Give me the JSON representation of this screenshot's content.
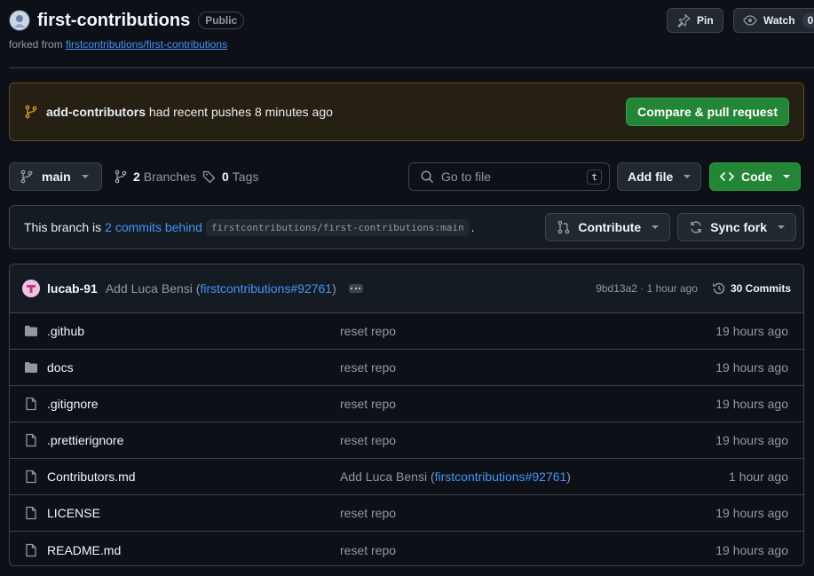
{
  "repo": {
    "name": "first-contributions",
    "visibility": "Public",
    "forked_prefix": "forked from",
    "forked_from": "firstcontributions/first-contributions"
  },
  "header_actions": {
    "pin_label": "Pin",
    "watch_label": "Watch",
    "watch_count": "0"
  },
  "recent_push": {
    "branch": "add-contributors",
    "text": "had recent pushes 8 minutes ago",
    "button": "Compare & pull request"
  },
  "toolbar": {
    "branch": "main",
    "branches_count": "2",
    "branches_label": "Branches",
    "tags_count": "0",
    "tags_label": "Tags",
    "search_placeholder": "Go to file",
    "search_shortcut": "t",
    "add_file": "Add file",
    "code": "Code"
  },
  "branch_info": {
    "prefix": "This branch is",
    "behind_link": "2 commits behind",
    "upstream": "firstcontributions/first-contributions:main",
    "suffix": ".",
    "contribute": "Contribute",
    "sync_fork": "Sync fork"
  },
  "last_commit": {
    "author": "lucab-91",
    "message_prefix": "Add Luca Bensi (",
    "message_link": "firstcontributions#92761",
    "message_suffix": ")",
    "hash_time": "9bd13a2 · 1 hour ago",
    "commits": "30 Commits"
  },
  "files": [
    {
      "name": ".github",
      "type": "folder",
      "message": "reset repo",
      "time": "19 hours ago"
    },
    {
      "name": "docs",
      "type": "folder",
      "message": "reset repo",
      "time": "19 hours ago"
    },
    {
      "name": ".gitignore",
      "type": "file",
      "message": "reset repo",
      "time": "19 hours ago"
    },
    {
      "name": ".prettierignore",
      "type": "file",
      "message": "reset repo",
      "time": "19 hours ago"
    },
    {
      "name": "Contributors.md",
      "type": "file",
      "message_prefix": "Add Luca Bensi (",
      "message_link": "firstcontributions#92761",
      "message_suffix": ")",
      "time": "1 hour ago"
    },
    {
      "name": "LICENSE",
      "type": "file",
      "message": "reset repo",
      "time": "19 hours ago"
    },
    {
      "name": "README.md",
      "type": "file",
      "message": "reset repo",
      "time": "19 hours ago"
    }
  ]
}
